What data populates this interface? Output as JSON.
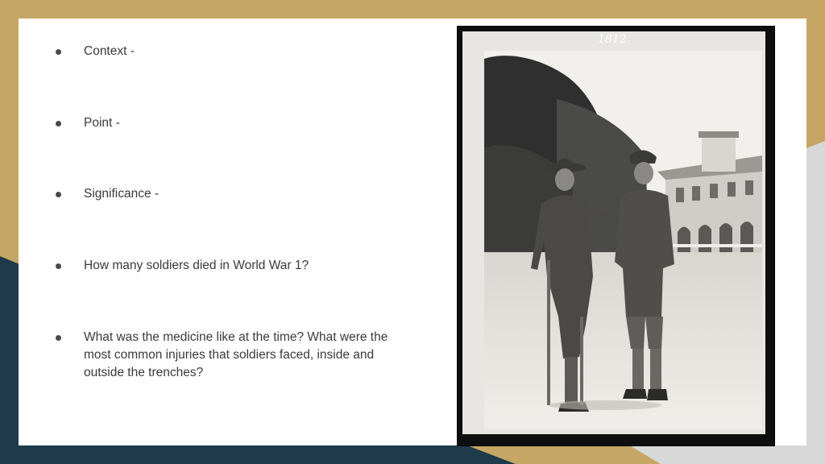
{
  "bullets": [
    {
      "text": "Context -"
    },
    {
      "text": "Point -"
    },
    {
      "text": "Significance -"
    },
    {
      "text": "How many soldiers died in World War 1?"
    },
    {
      "text": "What was the medicine like at the time?  What were the most common injuries that soldiers faced, inside and outside the trenches?"
    }
  ],
  "photo": {
    "number": "1812"
  },
  "colors": {
    "tan": "#c6a664",
    "navy": "#1f3a4a",
    "slide": "#ffffff",
    "text": "#3a3a3a"
  }
}
